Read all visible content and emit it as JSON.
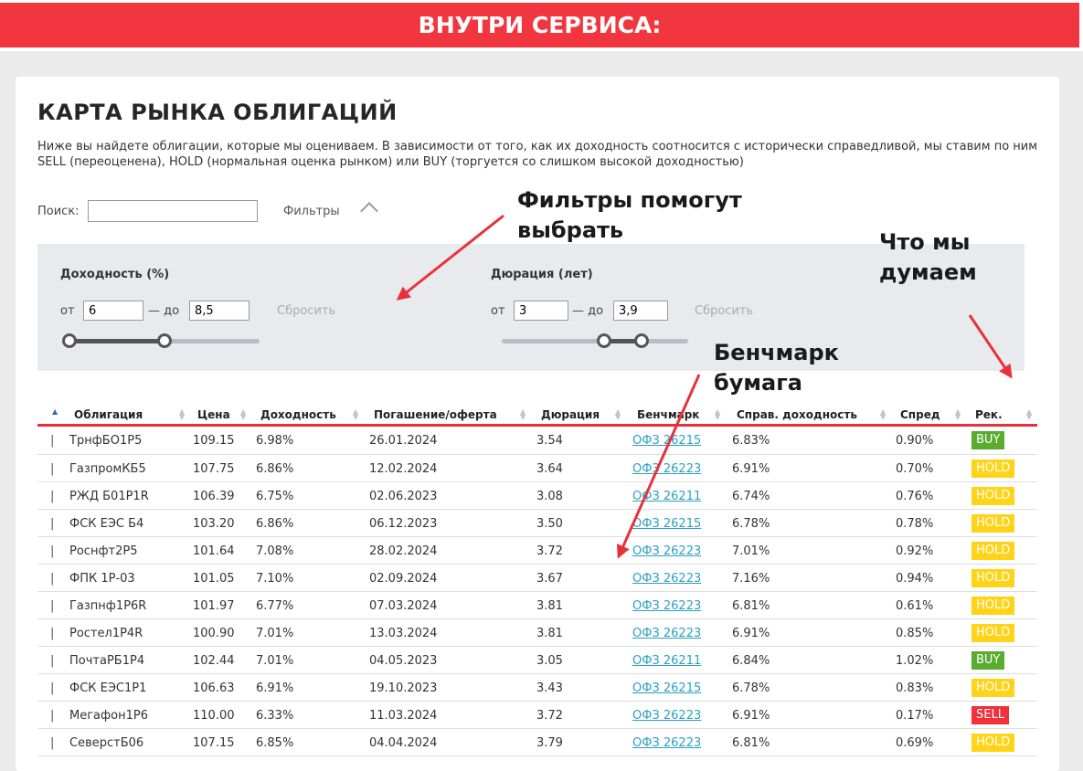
{
  "banner": {
    "title": "ВНУТРИ СЕРВИСА:"
  },
  "page": {
    "title": "КАРТА РЫНКА ОБЛИГАЦИЙ",
    "description": "Ниже вы найдете облигации, которые мы оцениваем. В зависимости от того, как их доходность соотносится с исторически справедливой, мы ставим по ним SELL (переоценена), HOLD (нормальная оценка рынком) или BUY (торгуется со слишком высокой доходностью)"
  },
  "search": {
    "label": "Поиск:",
    "value": ""
  },
  "filters": {
    "toggle_label": "Фильтры",
    "yield": {
      "heading": "Доходность (%)",
      "from_label": "от",
      "to_label": "— до",
      "from": "6",
      "to": "8,5",
      "reset": "Сбросить",
      "range_low_pct": 0.0,
      "range_high_pct": 0.5
    },
    "duration": {
      "heading": "Дюрация (лет)",
      "from_label": "от",
      "to_label": "— до",
      "from": "3",
      "to": "3,9",
      "reset": "Сбросить",
      "range_low_pct": 0.55,
      "range_high_pct": 0.75
    }
  },
  "annotations": {
    "filters": [
      "Фильтры помогут",
      "выбрать"
    ],
    "opinion": [
      "Что мы",
      "думаем"
    ],
    "benchmark": [
      "Бенчмарк",
      "бумага"
    ]
  },
  "table": {
    "columns": [
      "Облигация",
      "Цена",
      "Доходность",
      "Погашение/оферта",
      "Дюрация",
      "Бенчмарк",
      "Справ. доходность",
      "Спред",
      "Рек."
    ],
    "rows": [
      {
        "bond": "ТрнфБО1Р5",
        "price": "109.15",
        "yield": "6.98%",
        "maturity": "26.01.2024",
        "duration": "3.54",
        "benchmark": "ОФЗ 26215",
        "fair_yield": "6.83%",
        "spread": "0.90%",
        "rec": "BUY"
      },
      {
        "bond": "ГазпромКБ5",
        "price": "107.75",
        "yield": "6.86%",
        "maturity": "12.02.2024",
        "duration": "3.64",
        "benchmark": "ОФЗ 26223",
        "fair_yield": "6.91%",
        "spread": "0.70%",
        "rec": "HOLD"
      },
      {
        "bond": "РЖД Б01Р1R",
        "price": "106.39",
        "yield": "6.75%",
        "maturity": "02.06.2023",
        "duration": "3.08",
        "benchmark": "ОФЗ 26211",
        "fair_yield": "6.74%",
        "spread": "0.76%",
        "rec": "HOLD"
      },
      {
        "bond": "ФСК ЕЭС Б4",
        "price": "103.20",
        "yield": "6.86%",
        "maturity": "06.12.2023",
        "duration": "3.50",
        "benchmark": "ОФЗ 26215",
        "fair_yield": "6.78%",
        "spread": "0.78%",
        "rec": "HOLD"
      },
      {
        "bond": "Роснфт2Р5",
        "price": "101.64",
        "yield": "7.08%",
        "maturity": "28.02.2024",
        "duration": "3.72",
        "benchmark": "ОФЗ 26223",
        "fair_yield": "7.01%",
        "spread": "0.92%",
        "rec": "HOLD"
      },
      {
        "bond": "ФПК 1Р-03",
        "price": "101.05",
        "yield": "7.10%",
        "maturity": "02.09.2024",
        "duration": "3.67",
        "benchmark": "ОФЗ 26223",
        "fair_yield": "7.16%",
        "spread": "0.94%",
        "rec": "HOLD"
      },
      {
        "bond": "Газпнф1Р6R",
        "price": "101.97",
        "yield": "6.77%",
        "maturity": "07.03.2024",
        "duration": "3.81",
        "benchmark": "ОФЗ 26223",
        "fair_yield": "6.81%",
        "spread": "0.61%",
        "rec": "HOLD"
      },
      {
        "bond": "Ростел1Р4R",
        "price": "100.90",
        "yield": "7.01%",
        "maturity": "13.03.2024",
        "duration": "3.81",
        "benchmark": "ОФЗ 26223",
        "fair_yield": "6.91%",
        "spread": "0.85%",
        "rec": "HOLD"
      },
      {
        "bond": "ПочтаРБ1Р4",
        "price": "102.44",
        "yield": "7.01%",
        "maturity": "04.05.2023",
        "duration": "3.05",
        "benchmark": "ОФЗ 26211",
        "fair_yield": "6.84%",
        "spread": "1.02%",
        "rec": "BUY"
      },
      {
        "bond": "ФСК ЕЭС1Р1",
        "price": "106.63",
        "yield": "6.91%",
        "maturity": "19.10.2023",
        "duration": "3.43",
        "benchmark": "ОФЗ 26215",
        "fair_yield": "6.78%",
        "spread": "0.83%",
        "rec": "HOLD"
      },
      {
        "bond": "Мегафон1Р6",
        "price": "110.00",
        "yield": "6.33%",
        "maturity": "11.03.2024",
        "duration": "3.72",
        "benchmark": "ОФЗ 26223",
        "fair_yield": "6.91%",
        "spread": "0.17%",
        "rec": "SELL"
      },
      {
        "bond": "СеверстБ06",
        "price": "107.15",
        "yield": "6.85%",
        "maturity": "04.04.2024",
        "duration": "3.79",
        "benchmark": "ОФЗ 26223",
        "fair_yield": "6.81%",
        "spread": "0.69%",
        "rec": "HOLD"
      }
    ]
  },
  "colors": {
    "banner": "#f2363f",
    "buy": "#59ac2e",
    "hold": "#ffd418",
    "sell": "#f0303b",
    "link": "#2ba0c2",
    "header_line": "#e8323a",
    "arrow": "#e8323a"
  }
}
